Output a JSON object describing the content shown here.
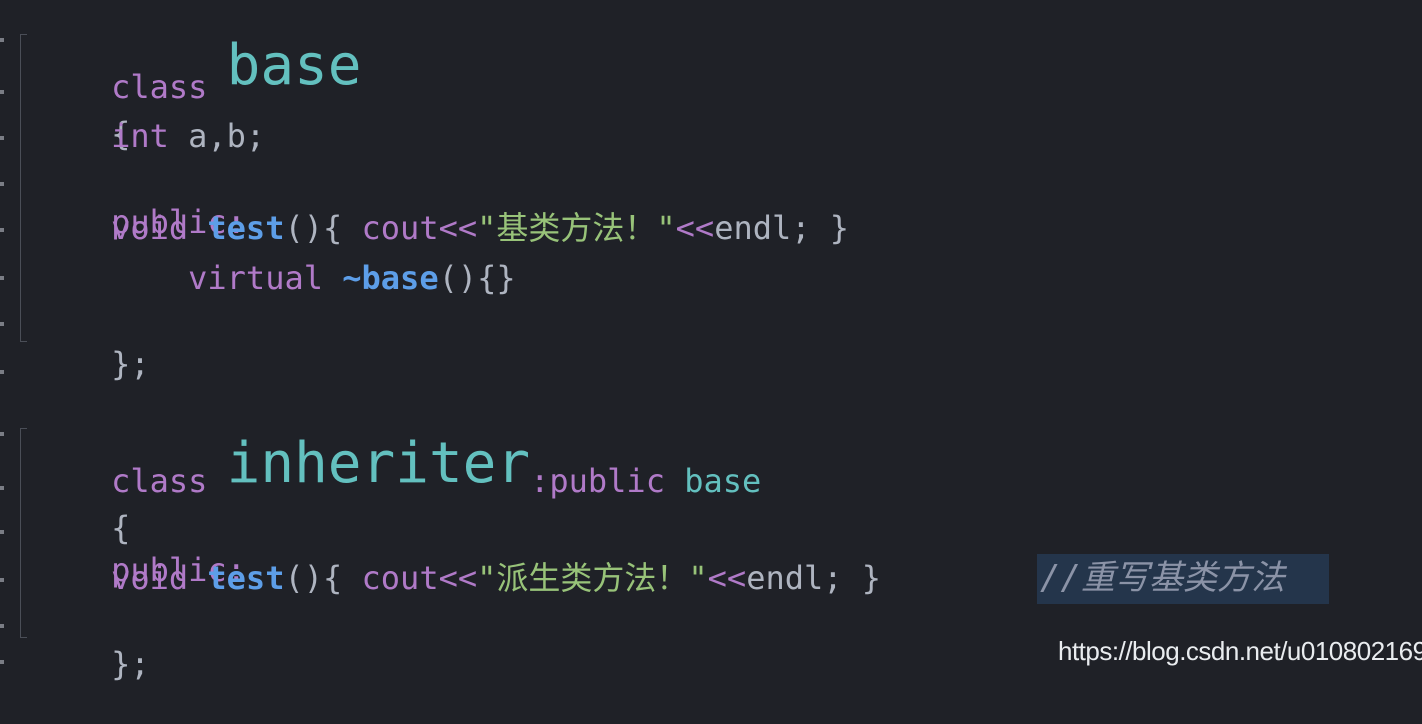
{
  "code": {
    "l1_kw": "class ",
    "l1_name": "base",
    "l2_brace": "{",
    "l3_type": "int",
    "l3_rest": " a,b;",
    "l4_kw": "public:",
    "l5_type": "void",
    "l5_fn": "test",
    "l5_paren": "(){ ",
    "l5_cout": "cout",
    "l5_op1": "<<",
    "l5_str": "\"基类方法！\"",
    "l5_op2": "<<",
    "l5_endl": "endl; }",
    "l6_kw": "virtual",
    "l6_fn": "~base",
    "l6_paren": "(){}",
    "l7_close": "};",
    "l9_kw": "class ",
    "l9_name": "inheriter",
    "l9_colon": ":",
    "l9_pub": "public",
    "l9_base": "base",
    "l10_brace": "{",
    "l11_kw": "public:",
    "l12_type": "void",
    "l12_fn": "test",
    "l12_paren": "(){ ",
    "l12_cout": "cout",
    "l12_op1": "<<",
    "l12_str": "\"派生类方法！\"",
    "l12_op2": "<<",
    "l12_endl": "endl; }",
    "l12_comment": "//重写基类方法",
    "l13_close": "};"
  },
  "watermark": "https://blog.csdn.net/u010802169"
}
